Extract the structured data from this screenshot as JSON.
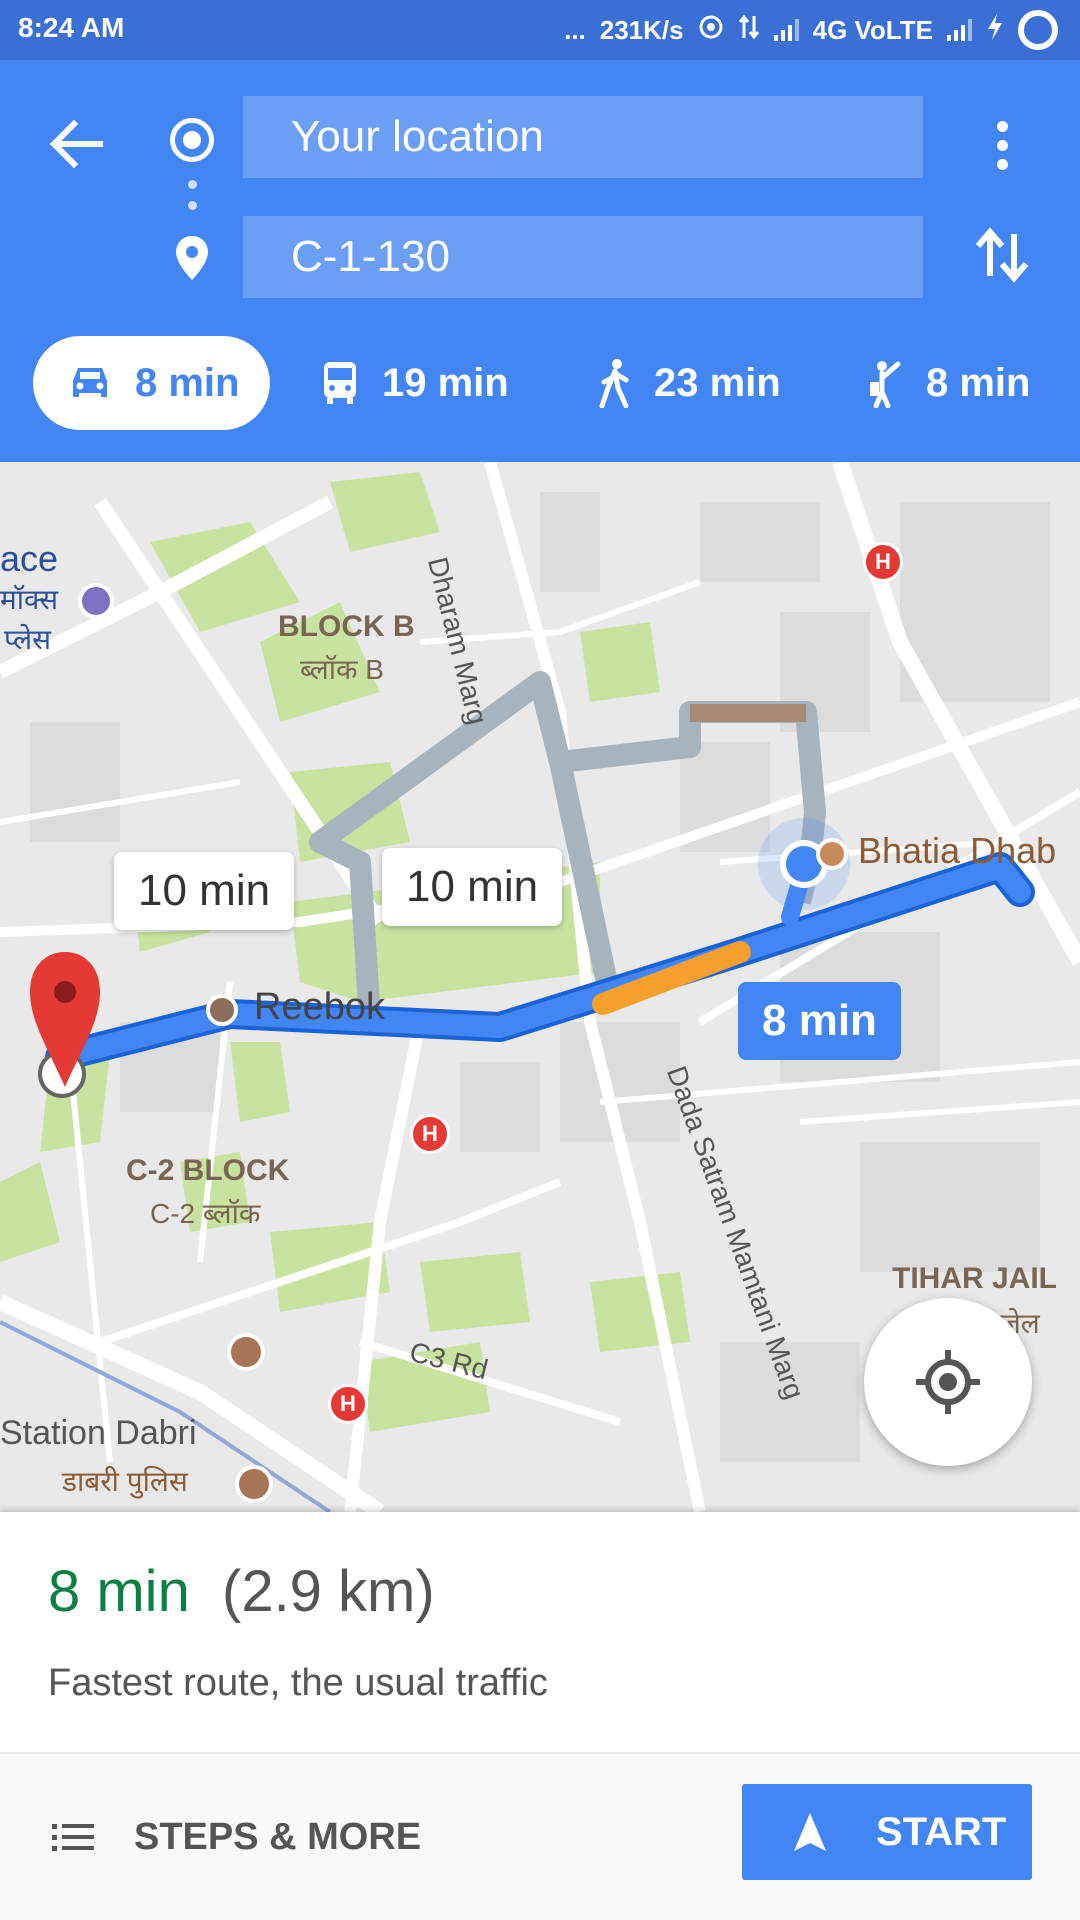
{
  "status_bar": {
    "time": "8:24 AM",
    "dots": "...",
    "speed": "231K/s",
    "network": "4G VoLTE"
  },
  "directions": {
    "from": "Your location",
    "to": "C-1-130"
  },
  "modes": [
    {
      "name": "drive",
      "label": "8 min"
    },
    {
      "name": "transit",
      "label": "19 min"
    },
    {
      "name": "walk",
      "label": "23 min"
    },
    {
      "name": "ride",
      "label": "8 min"
    }
  ],
  "map": {
    "labels": {
      "ace": "ace",
      "mall_hi": "मॉक्स",
      "place_hi": "प्लेस",
      "block_b": "BLOCK B",
      "block_b_hi": "ब्लॉक B",
      "dharam_marg": "Dharam Marg",
      "bhatia": "Bhatia Dhab",
      "reebok": "Reebok",
      "c2_block": "C-2 BLOCK",
      "c2_block_hi": "C-2 ब्लॉक",
      "dada_satram": "Dada Satram Mamtani Marg",
      "tihar": "TIHAR JAIL",
      "tihar_hi": "जेल",
      "c3_rd": "C3 Rd",
      "station": "Station Dabri",
      "station_hi": "डाबरी पुलिस"
    },
    "route_bubbles": {
      "alt1": "10 min",
      "alt2": "10 min",
      "main": "8 min"
    },
    "hospital_icon": "H",
    "colors": {
      "route_main": "#4285f4",
      "route_alt": "#a7b3bd",
      "traffic_slow": "#f4a02b",
      "park": "#c8e3a0"
    }
  },
  "summary": {
    "eta": "8 min",
    "distance": "(2.9 km)",
    "description": "Fastest route, the usual traffic"
  },
  "actions": {
    "steps": "STEPS & MORE",
    "start": "START"
  }
}
